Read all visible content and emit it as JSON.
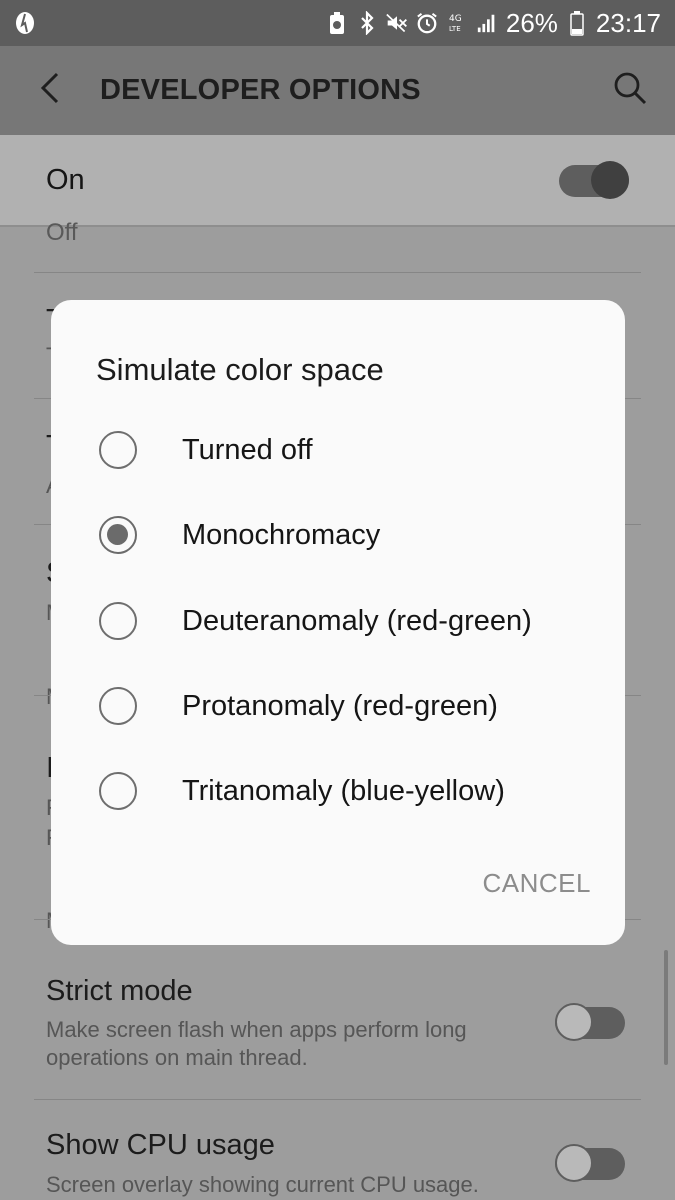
{
  "status_bar": {
    "battery_percent": "26%",
    "time": "23:17",
    "icons": [
      "app-notification-icon",
      "battery-saver-icon",
      "bluetooth-icon",
      "mute-icon",
      "alarm-icon",
      "data-4g-icon",
      "signal-icon",
      "battery-icon"
    ]
  },
  "app_bar": {
    "title": "DEVELOPER OPTIONS"
  },
  "master_switch": {
    "label": "On",
    "state": "on"
  },
  "background_items": {
    "partial_top_value": "Off",
    "hidden_row_1_title_initial": "T",
    "hidden_row_1_sub_initial": "T",
    "hidden_row_2_title_initial": "T",
    "hidden_row_2_sub_initial": "A",
    "hidden_row_3_title_initial": "S",
    "hidden_row_3_sub_initial": "M",
    "hidden_section_1_initial": "M",
    "hidden_row_4_title_initial": "I",
    "hidden_row_4_sub1_initial": "F",
    "hidden_row_4_sub2_initial": "F",
    "hidden_section_2_initial": "M",
    "strict_mode": {
      "title": "Strict mode",
      "subtitle_line1": "Make screen flash when apps perform long",
      "subtitle_line2": "operations on main thread.",
      "state": "off"
    },
    "show_cpu": {
      "title": "Show CPU usage",
      "subtitle": "Screen overlay showing current CPU usage.",
      "state": "off"
    }
  },
  "dialog": {
    "title": "Simulate color space",
    "options": [
      {
        "label": "Turned off",
        "selected": false
      },
      {
        "label": "Monochromacy",
        "selected": true
      },
      {
        "label": "Deuteranomaly (red-green)",
        "selected": false
      },
      {
        "label": "Protanomaly (red-green)",
        "selected": false
      },
      {
        "label": "Tritanomaly (blue-yellow)",
        "selected": false
      }
    ],
    "cancel_label": "CANCEL"
  }
}
